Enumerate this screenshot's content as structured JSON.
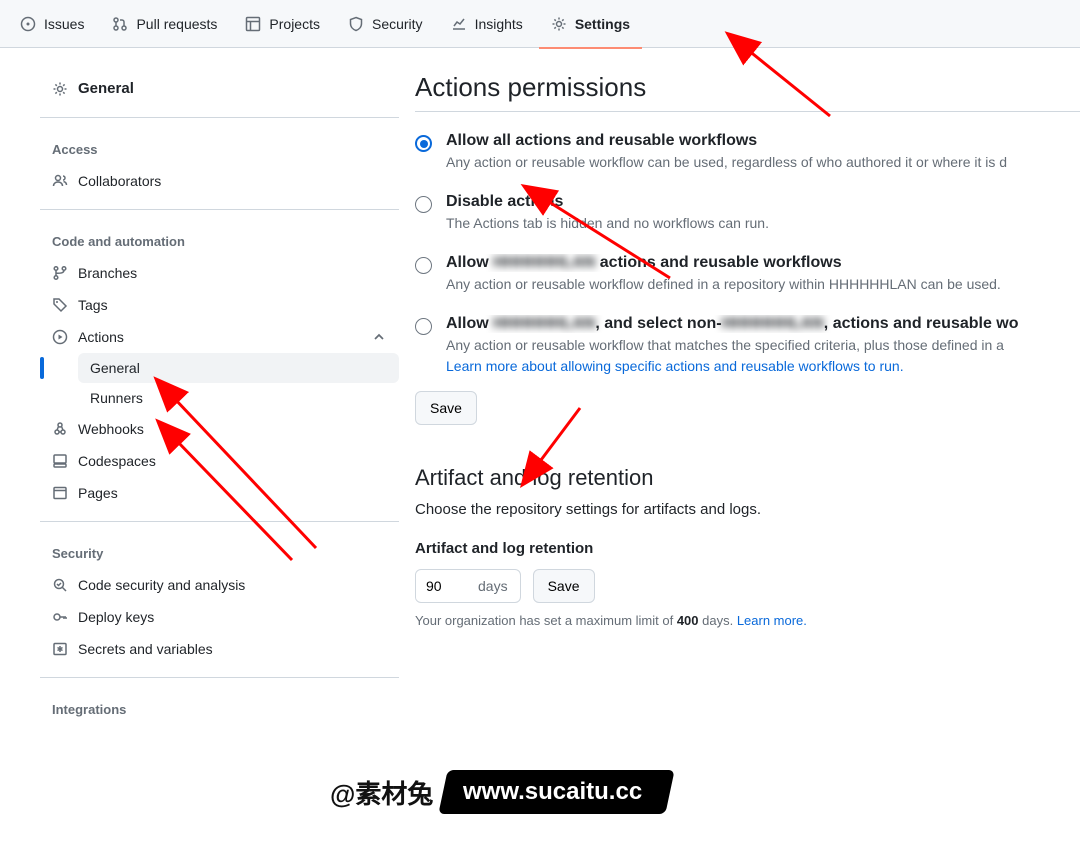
{
  "topnav": {
    "issues": "Issues",
    "pulls": "Pull requests",
    "projects": "Projects",
    "security": "Security",
    "insights": "Insights",
    "settings": "Settings"
  },
  "sidebar": {
    "general": "General",
    "access_heading": "Access",
    "collaborators": "Collaborators",
    "code_heading": "Code and automation",
    "branches": "Branches",
    "tags": "Tags",
    "actions": "Actions",
    "actions_general": "General",
    "actions_runners": "Runners",
    "webhooks": "Webhooks",
    "codespaces": "Codespaces",
    "pages": "Pages",
    "security_heading": "Security",
    "code_security": "Code security and analysis",
    "deploy_keys": "Deploy keys",
    "secrets": "Secrets and variables",
    "integrations_heading": "Integrations"
  },
  "main": {
    "title": "Actions permissions",
    "opt1_title": "Allow all actions and reusable workflows",
    "opt1_desc": "Any action or reusable workflow can be used, regardless of who authored it or where it is d",
    "opt2_title": "Disable actions",
    "opt2_desc": "The Actions tab is hidden and no workflows can run.",
    "opt3_pre": "Allow ",
    "opt3_blur": "HHHHHHLAN",
    "opt3_post": " actions and reusable workflows",
    "opt3_desc": "Any action or reusable workflow defined in a repository within HHHHHHLAN can be used.",
    "opt4_pre": "Allow ",
    "opt4_blur1": "HHHHHHLAN",
    "opt4_mid": ", and select non-",
    "opt4_blur2": "HHHHHHLAN",
    "opt4_post": ", actions and reusable wo",
    "opt4_desc_a": "Any action or reusable workflow that matches the specified criteria, plus those defined in a",
    "opt4_link": "Learn more about allowing specific actions and reusable workflows to run.",
    "save_btn": "Save",
    "retention_title": "Artifact and log retention",
    "retention_desc": "Choose the repository settings for artifacts and logs.",
    "retention_label": "Artifact and log retention",
    "retention_value": "90",
    "retention_unit": "days",
    "retention_save": "Save",
    "retention_help_a": "Your organization has set a maximum limit of ",
    "retention_help_bold": "400",
    "retention_help_b": " days. ",
    "retention_help_link": "Learn more."
  },
  "watermark": {
    "at": "@素材兔",
    "url": "www.sucaitu.cc"
  }
}
